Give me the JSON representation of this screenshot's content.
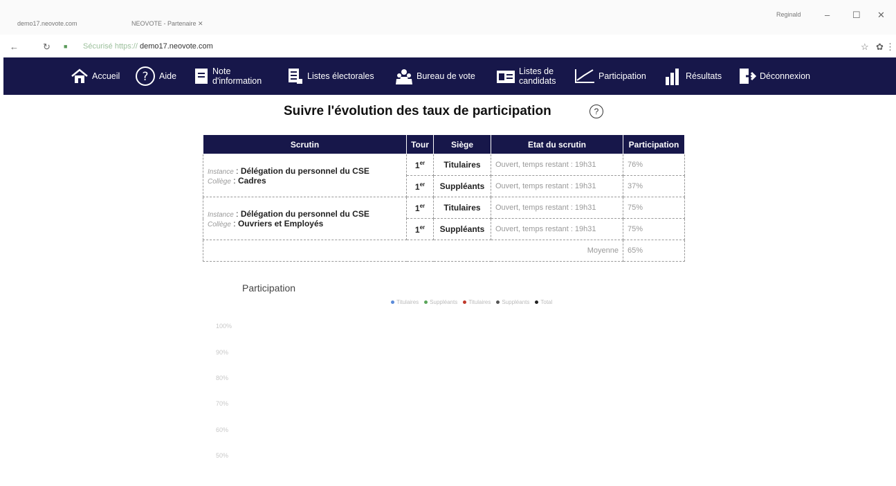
{
  "browser": {
    "tabs": [
      "demo17.neovote.com",
      "NEOVOTE - Partenaire"
    ],
    "url_secure": "Sécurisé",
    "url_scheme": "https://",
    "url_host": "demo17.neovote.com",
    "window_user": "Reginald"
  },
  "nav": {
    "items": [
      {
        "label": "Accueil",
        "icon": "home-icon"
      },
      {
        "label": "Aide",
        "icon": "help-icon"
      },
      {
        "label_line1": "Note",
        "label_line2": "d'information",
        "icon": "document-icon"
      },
      {
        "label": "Listes électorales",
        "icon": "list-icon"
      },
      {
        "label": "Bureau de vote",
        "icon": "people-icon"
      },
      {
        "label_line1": "Listes de",
        "label_line2": "candidats",
        "icon": "id-card-icon"
      },
      {
        "label": "Participation",
        "icon": "line-chart-icon"
      },
      {
        "label": "Résultats",
        "icon": "bar-chart-icon"
      },
      {
        "label": "Déconnexion",
        "icon": "logout-icon"
      }
    ]
  },
  "page": {
    "title": "Suivre l'évolution des taux de participation",
    "help_icon": "?"
  },
  "table": {
    "headers": [
      "Scrutin",
      "Tour",
      "Siège",
      "Etat du scrutin",
      "Participation"
    ],
    "instance_label": "Instance",
    "college_label": "Collège",
    "groups": [
      {
        "instance": "Délégation du personnel du CSE",
        "college": "Cadres",
        "rows": [
          {
            "tour": "1",
            "tour_sup": "er",
            "siege": "Titulaires",
            "etat": "Ouvert, temps restant : 19h31",
            "participation": "76%"
          },
          {
            "tour": "1",
            "tour_sup": "er",
            "siege": "Suppléants",
            "etat": "Ouvert, temps restant : 19h31",
            "participation": "37%"
          }
        ]
      },
      {
        "instance": "Délégation du personnel du CSE",
        "college": "Ouvriers et Employés",
        "rows": [
          {
            "tour": "1",
            "tour_sup": "er",
            "siege": "Titulaires",
            "etat": "Ouvert, temps restant : 19h31",
            "participation": "75%"
          },
          {
            "tour": "1",
            "tour_sup": "er",
            "siege": "Suppléants",
            "etat": "Ouvert, temps restant : 19h31",
            "participation": "75%"
          }
        ]
      }
    ],
    "average_label": "Moyenne",
    "average_value": "65%"
  },
  "chart": {
    "title": "Participation",
    "legend": [
      {
        "name": "Titulaires",
        "color": "#5b8bd9"
      },
      {
        "name": "Suppléants",
        "color": "#5aa55a"
      },
      {
        "name": "Titulaires",
        "color": "#c0392b"
      },
      {
        "name": "Suppléants",
        "color": "#555555"
      },
      {
        "name": "Total",
        "color": "#222222"
      }
    ],
    "yticks": [
      "100%",
      "90%",
      "80%",
      "70%",
      "60%",
      "50%"
    ]
  }
}
